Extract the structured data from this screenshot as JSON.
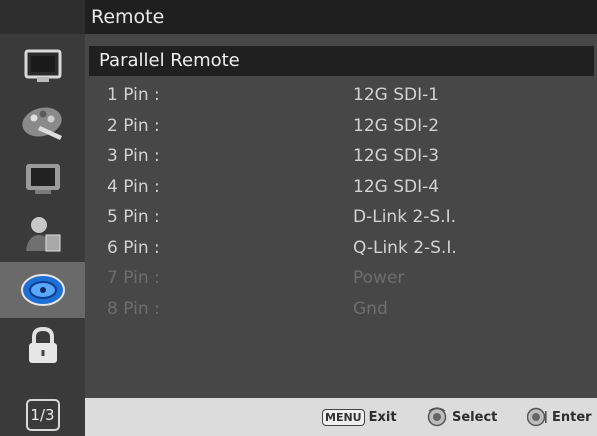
{
  "header": {
    "title": "Remote"
  },
  "section": {
    "title": "Parallel Remote"
  },
  "rows": [
    {
      "key": "1 Pin :",
      "value": "12G SDI-1"
    },
    {
      "key": "2 Pin :",
      "value": "12G SDI-2"
    },
    {
      "key": "3 Pin :",
      "value": "12G SDI-3"
    },
    {
      "key": "4 Pin :",
      "value": "12G SDI-4"
    },
    {
      "key": "5 Pin :",
      "value": "D-Link 2-S.I."
    },
    {
      "key": "6 Pin :",
      "value": "Q-Link 2-S.I."
    },
    {
      "key": "7 Pin :",
      "value": "Power"
    },
    {
      "key": "8 Pin :",
      "value": "Gnd"
    }
  ],
  "rail": {
    "items": [
      {
        "icon": "monitor-icon"
      },
      {
        "icon": "color-palette-icon"
      },
      {
        "icon": "display-icon"
      },
      {
        "icon": "user-icon"
      },
      {
        "icon": "remote-disc-icon",
        "selected": true
      },
      {
        "icon": "lock-icon"
      }
    ],
    "page": "1/3"
  },
  "footer": {
    "menu_key": "MENU",
    "exit_label": "Exit",
    "select_label": "Select",
    "enter_label": "Enter"
  },
  "colors": {
    "panel": "#474747",
    "header": "#1f1f1f",
    "section": "#202020",
    "selected_rail": "#6a6a6a",
    "footer": "#dcdcdc"
  }
}
